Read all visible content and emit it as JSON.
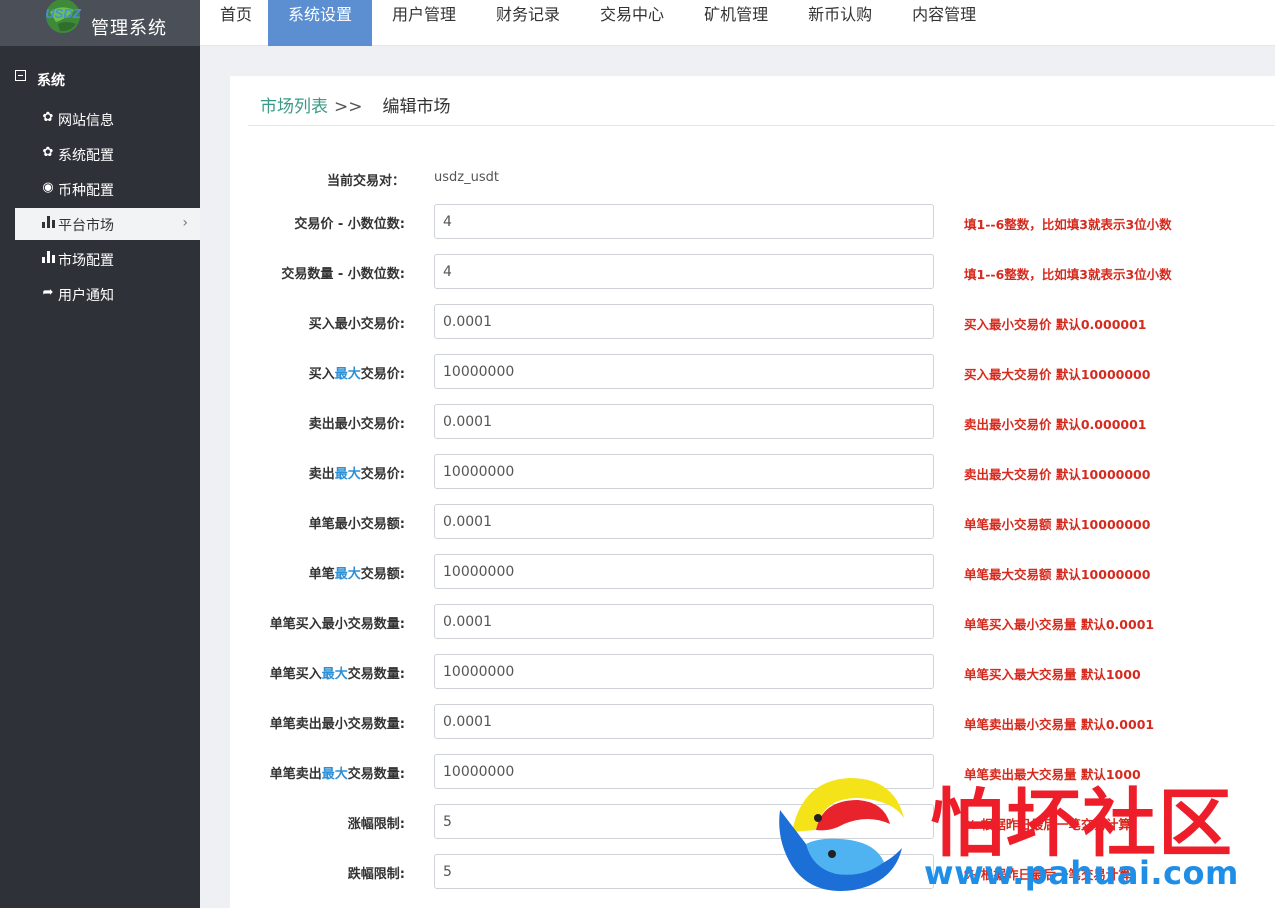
{
  "brand": {
    "logo_text": "USDZ",
    "title": "管理系统"
  },
  "nav": [
    "首页",
    "系统设置",
    "用户管理",
    "财务记录",
    "交易中心",
    "矿机管理",
    "新币认购",
    "内容管理"
  ],
  "nav_active": "系统设置",
  "sidebar": {
    "group": "系统",
    "items": [
      {
        "label": "网站信息",
        "icon": "gear-icon"
      },
      {
        "label": "系统配置",
        "icon": "gear-icon"
      },
      {
        "label": "币种配置",
        "icon": "target-icon"
      },
      {
        "label": "平台市场",
        "icon": "bar-chart-icon",
        "active": true
      },
      {
        "label": "市场配置",
        "icon": "bar-chart-icon"
      },
      {
        "label": "用户通知",
        "icon": "share-arrow-icon"
      }
    ]
  },
  "breadcrumb": {
    "parent": "市场列表",
    "separator": ">>",
    "current": "编辑市场"
  },
  "form": {
    "pair": {
      "label": "当前交易对：",
      "value": "usdz_usdt"
    },
    "fields": [
      {
        "label_pre": "交易价 - 小数位数:",
        "label_hl": "",
        "label_post": "",
        "value": "4",
        "tip": "填1--6整数，比如填3就表示3位小数"
      },
      {
        "label_pre": "交易数量 - 小数位数:",
        "label_hl": "",
        "label_post": "",
        "value": "4",
        "tip": "填1--6整数，比如填3就表示3位小数"
      },
      {
        "label_pre": "买入最小交易价:",
        "label_hl": "",
        "label_post": "",
        "value": "0.0001",
        "tip": "买入最小交易价 默认0.000001"
      },
      {
        "label_pre": "买入",
        "label_hl": "最大",
        "label_post": "交易价:",
        "value": "10000000",
        "tip": "买入最大交易价 默认10000000"
      },
      {
        "label_pre": "卖出最小交易价:",
        "label_hl": "",
        "label_post": "",
        "value": "0.0001",
        "tip": "卖出最小交易价 默认0.000001"
      },
      {
        "label_pre": "卖出",
        "label_hl": "最大",
        "label_post": "交易价:",
        "value": "10000000",
        "tip": "卖出最大交易价 默认10000000"
      },
      {
        "label_pre": "单笔最小交易额:",
        "label_hl": "",
        "label_post": "",
        "value": "0.0001",
        "tip": "单笔最小交易额 默认10000000"
      },
      {
        "label_pre": "单笔",
        "label_hl": "最大",
        "label_post": "交易额:",
        "value": "10000000",
        "tip": "单笔最大交易额 默认10000000"
      },
      {
        "label_pre": "单笔买入最小交易数量:",
        "label_hl": "",
        "label_post": "",
        "value": "0.0001",
        "tip": "单笔买入最小交易量 默认0.0001"
      },
      {
        "label_pre": "单笔买入",
        "label_hl": "最大",
        "label_post": "交易数量:",
        "value": "10000000",
        "tip": "单笔买入最大交易量 默认1000"
      },
      {
        "label_pre": "单笔卖出最小交易数量:",
        "label_hl": "",
        "label_post": "",
        "value": "0.0001",
        "tip": "单笔卖出最小交易量 默认0.0001"
      },
      {
        "label_pre": "单笔卖出",
        "label_hl": "最大",
        "label_post": "交易数量:",
        "value": "10000000",
        "tip": "单笔卖出最大交易量 默认1000"
      },
      {
        "label_pre": "涨幅限制:",
        "label_hl": "",
        "label_post": "",
        "value": "5",
        "tip": "% 根据昨日最后一笔交易计算"
      },
      {
        "label_pre": "跌幅限制:",
        "label_hl": "",
        "label_post": "",
        "value": "5",
        "tip": "% 根据昨日最后一笔交易计算"
      }
    ]
  },
  "watermark": {
    "title": "怕坏社区",
    "url": "www.pahuai.com"
  },
  "colors": {
    "sidebar_bg": "#2e3138",
    "nav_active": "#5b8fd1",
    "tip_red": "#d62a1e",
    "highlight_blue": "#2d8fd5",
    "breadcrumb_green": "#3a9a87"
  }
}
